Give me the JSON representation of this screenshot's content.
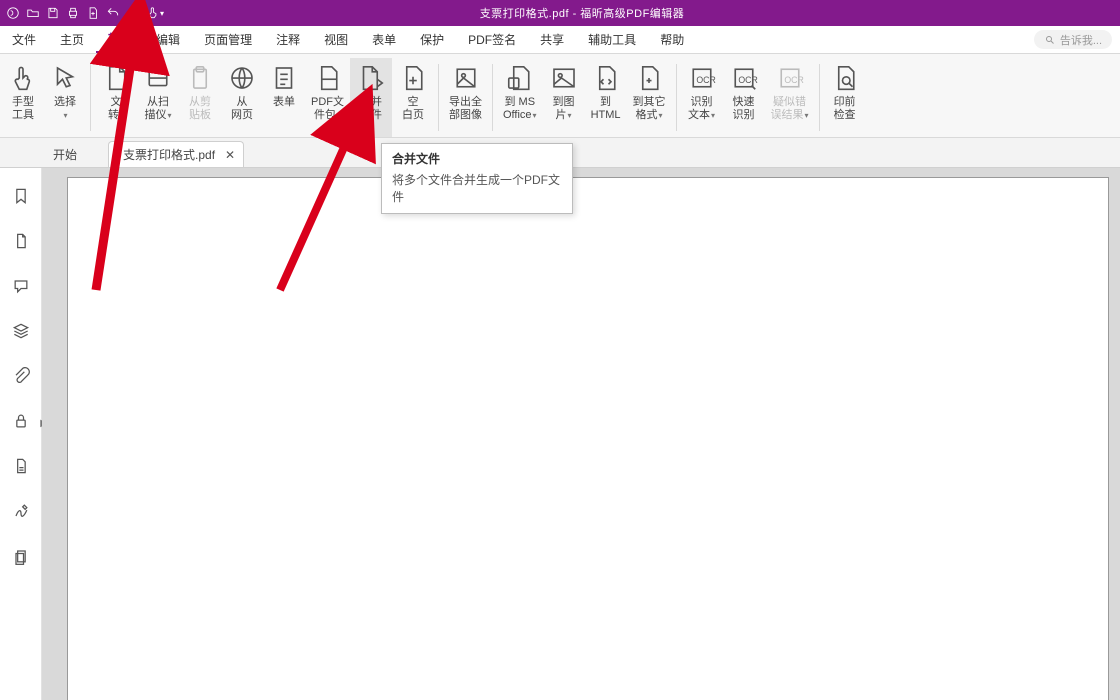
{
  "titlebar": {
    "title": "支票打印格式.pdf - 福昕高级PDF编辑器"
  },
  "menu": {
    "items": [
      "文件",
      "主页",
      "转换",
      "编辑",
      "页面管理",
      "注释",
      "视图",
      "表单",
      "保护",
      "PDF签名",
      "共享",
      "辅助工具",
      "帮助"
    ],
    "active_index": 2,
    "tellme_placeholder": "告诉我..."
  },
  "ribbon": [
    {
      "l1": "手型",
      "l2": "工具",
      "dd": false,
      "icon": "hand",
      "disabled": false
    },
    {
      "l1": "选择",
      "l2": "",
      "dd": true,
      "icon": "select",
      "disabled": false
    },
    {
      "sep": true
    },
    {
      "l1": "文",
      "l2": "转",
      "dd": true,
      "icon": "doc",
      "disabled": false
    },
    {
      "l1": "从扫",
      "l2": "描仪",
      "dd": true,
      "icon": "scanner",
      "disabled": false
    },
    {
      "l1": "从剪",
      "l2": "贴板",
      "dd": false,
      "icon": "clip",
      "disabled": true
    },
    {
      "l1": "从",
      "l2": "网页",
      "dd": false,
      "icon": "globe",
      "disabled": false
    },
    {
      "l1": "表单",
      "l2": "",
      "dd": false,
      "icon": "form",
      "disabled": false
    },
    {
      "l1": "PDF文",
      "l2": "件包",
      "dd": true,
      "icon": "package",
      "disabled": false
    },
    {
      "l1": "合并",
      "l2": "文件",
      "dd": false,
      "icon": "merge",
      "disabled": false,
      "highlight": true
    },
    {
      "l1": "空",
      "l2": "白页",
      "dd": false,
      "icon": "blank",
      "disabled": false
    },
    {
      "sep": true
    },
    {
      "l1": "导出全",
      "l2": "部图像",
      "dd": false,
      "icon": "export-img",
      "disabled": false
    },
    {
      "sep": true
    },
    {
      "l1": "到 MS",
      "l2": "Office",
      "dd": true,
      "icon": "office",
      "disabled": false
    },
    {
      "l1": "到图",
      "l2": "片",
      "dd": true,
      "icon": "image",
      "disabled": false
    },
    {
      "l1": "到",
      "l2": "HTML",
      "dd": false,
      "icon": "html",
      "disabled": false
    },
    {
      "l1": "到其它",
      "l2": "格式",
      "dd": true,
      "icon": "other",
      "disabled": false
    },
    {
      "sep": true
    },
    {
      "l1": "识别",
      "l2": "文本",
      "dd": true,
      "icon": "ocr",
      "disabled": false
    },
    {
      "l1": "快速",
      "l2": "识别",
      "dd": false,
      "icon": "ocr-fast",
      "disabled": false
    },
    {
      "l1": "疑似错",
      "l2": "误结果",
      "dd": true,
      "icon": "ocr-err",
      "disabled": true
    },
    {
      "sep": true
    },
    {
      "l1": "印前",
      "l2": "检查",
      "dd": false,
      "icon": "preflight",
      "disabled": false
    }
  ],
  "tabs": [
    {
      "label": "开始",
      "active": false,
      "closable": false
    },
    {
      "label": "支票打印格式.pdf",
      "active": true,
      "closable": true
    }
  ],
  "tooltip": {
    "title": "合并文件",
    "desc": "将多个文件合并生成一个PDF文件"
  },
  "sidebar_icons": [
    "bookmark",
    "page",
    "comment",
    "layers",
    "attach",
    "security",
    "fill",
    "sign",
    "clipboard"
  ]
}
